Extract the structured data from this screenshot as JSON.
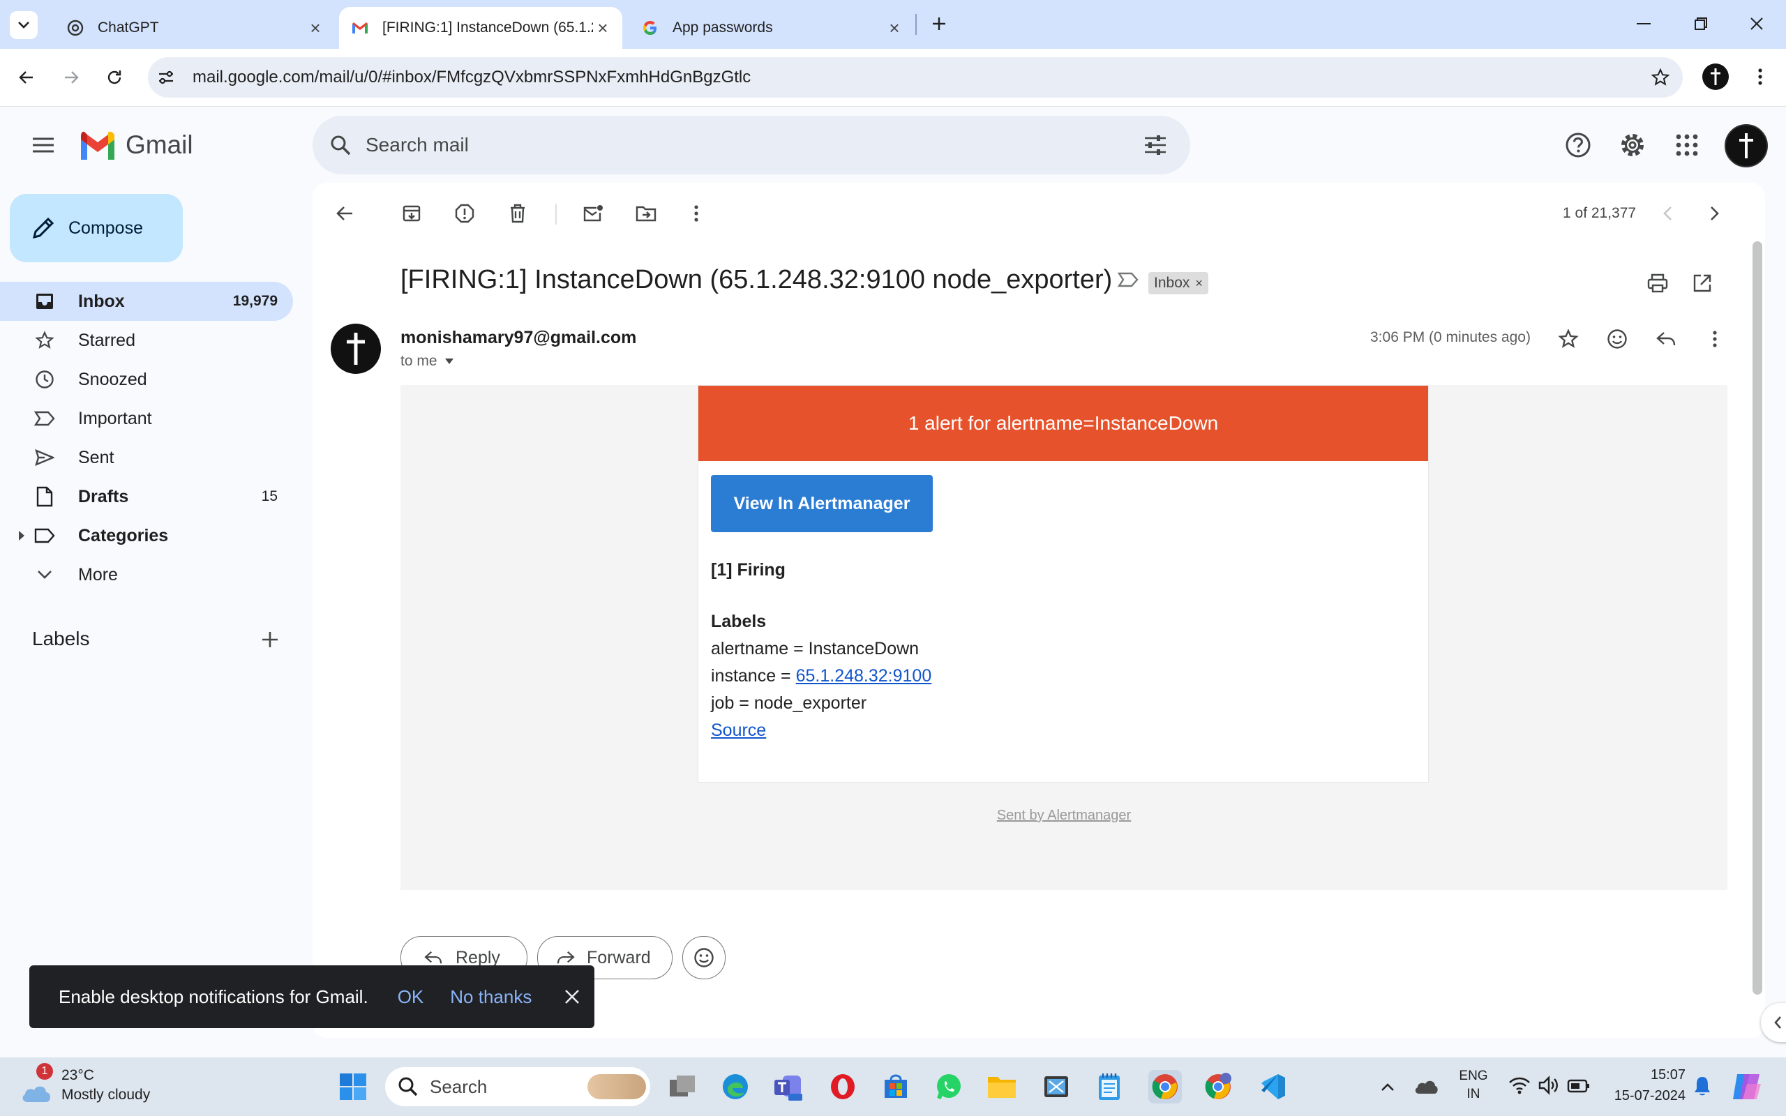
{
  "browser": {
    "tabs": [
      {
        "title": "ChatGPT",
        "icon": "chatgpt-icon"
      },
      {
        "title": "[FIRING:1] InstanceDown (65.1.2",
        "icon": "gmail-icon"
      },
      {
        "title": "App passwords",
        "icon": "google-icon"
      }
    ],
    "url": "mail.google.com/mail/u/0/#inbox/FMfcgzQVxbmrSSPNxFxmhHdGnBgzGtlc"
  },
  "gmail": {
    "brand": "Gmail",
    "search_placeholder": "Search mail",
    "compose_label": "Compose",
    "nav": [
      {
        "label": "Inbox",
        "count": "19,979",
        "icon": "inbox-icon"
      },
      {
        "label": "Starred",
        "count": "",
        "icon": "star-icon"
      },
      {
        "label": "Snoozed",
        "count": "",
        "icon": "clock-icon"
      },
      {
        "label": "Important",
        "count": "",
        "icon": "important-icon"
      },
      {
        "label": "Sent",
        "count": "",
        "icon": "send-icon"
      },
      {
        "label": "Drafts",
        "count": "15",
        "icon": "draft-icon"
      },
      {
        "label": "Categories",
        "count": "",
        "icon": "label-icon"
      },
      {
        "label": "More",
        "count": "",
        "icon": "chevron-down-icon"
      }
    ],
    "labels_heading": "Labels",
    "pagination": "1 of 21,377"
  },
  "message": {
    "subject": "[FIRING:1] InstanceDown (65.1.248.32:9100 node_exporter)",
    "inbox_chip": "Inbox",
    "sender": "monishamary97@gmail.com",
    "to": "to me",
    "time": "3:06 PM (0 minutes ago)",
    "body": {
      "banner": "1 alert for alertname=InstanceDown",
      "button": "View In Alertmanager",
      "firing": "[1] Firing",
      "labels_title": "Labels",
      "line_alertname": "alertname = InstanceDown",
      "instance_prefix": "instance = ",
      "instance_link": "65.1.248.32:9100",
      "line_job": "job = node_exporter",
      "source_link": "Source",
      "sent_by": "Sent by Alertmanager"
    },
    "reply_label": "Reply",
    "forward_label": "Forward"
  },
  "toast": {
    "text": "Enable desktop notifications for Gmail.",
    "ok": "OK",
    "no_thanks": "No thanks"
  },
  "taskbar": {
    "weather_temp": "23°C",
    "weather_desc": "Mostly cloudy",
    "weather_badge": "1",
    "search_label": "Search",
    "lang_line1": "ENG",
    "lang_line2": "IN",
    "time": "15:07",
    "date": "15-07-2024"
  },
  "colors": {
    "alert_banner": "#e6522c",
    "alert_button": "#2b7dd4",
    "compose_bg": "#c2e7ff",
    "selected_nav": "#d3e3fd"
  }
}
